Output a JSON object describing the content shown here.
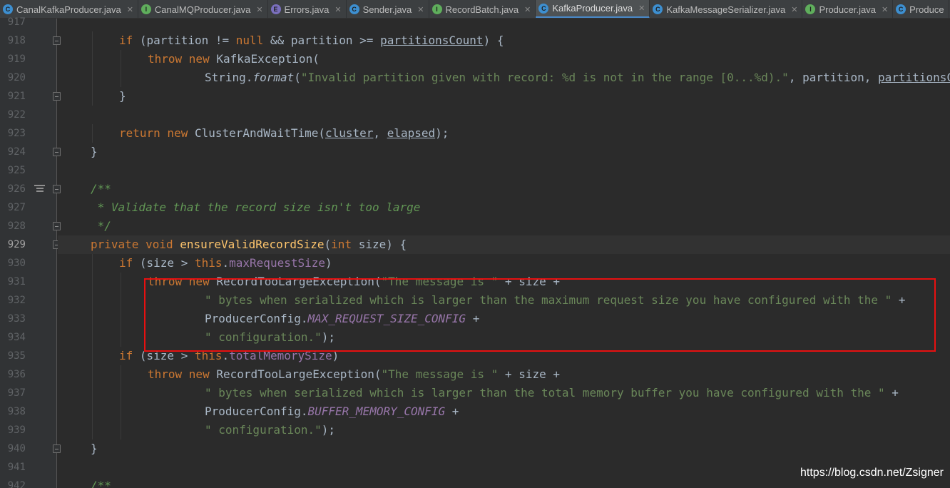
{
  "tabs": [
    {
      "label": "CanalKafkaProducer.java",
      "kind": "class",
      "active": false
    },
    {
      "label": "CanalMQProducer.java",
      "kind": "interface",
      "active": false
    },
    {
      "label": "Errors.java",
      "kind": "enum",
      "active": false
    },
    {
      "label": "Sender.java",
      "kind": "class",
      "active": false
    },
    {
      "label": "RecordBatch.java",
      "kind": "interface",
      "active": false
    },
    {
      "label": "KafkaProducer.java",
      "kind": "class",
      "active": true
    },
    {
      "label": "KafkaMessageSerializer.java",
      "kind": "class",
      "active": false
    },
    {
      "label": "Producer.java",
      "kind": "interface",
      "active": false
    },
    {
      "label": "Produce",
      "kind": "class",
      "active": false
    }
  ],
  "code_lines": [
    {
      "num": "917",
      "indent": 0,
      "tokens": []
    },
    {
      "num": "918",
      "indent": 2,
      "fold": true,
      "tokens": [
        {
          "t": "if",
          "c": "kw"
        },
        {
          "t": " (partition != "
        },
        {
          "t": "null",
          "c": "kw"
        },
        {
          "t": " && partition >= "
        },
        {
          "t": "partitionsCount",
          "c": "uline"
        },
        {
          "t": ") {"
        }
      ]
    },
    {
      "num": "919",
      "indent": 3,
      "tokens": [
        {
          "t": "throw new",
          "c": "kw"
        },
        {
          "t": " KafkaException("
        }
      ]
    },
    {
      "num": "920",
      "indent": 5,
      "tokens": [
        {
          "t": "String."
        },
        {
          "t": "format",
          "c": "ital"
        },
        {
          "t": "("
        },
        {
          "t": "\"Invalid partition given with record: %d is not in the range [0...%d).\"",
          "c": "str"
        },
        {
          "t": ", partition, "
        },
        {
          "t": "partitionsCount",
          "c": "uline"
        }
      ]
    },
    {
      "num": "921",
      "indent": 2,
      "fold": true,
      "tokens": [
        {
          "t": "}"
        }
      ]
    },
    {
      "num": "922",
      "indent": 0,
      "tokens": []
    },
    {
      "num": "923",
      "indent": 2,
      "tokens": [
        {
          "t": "return new",
          "c": "kw"
        },
        {
          "t": " ClusterAndWaitTime("
        },
        {
          "t": "cluster",
          "c": "uline"
        },
        {
          "t": ", "
        },
        {
          "t": "elapsed",
          "c": "uline"
        },
        {
          "t": ");"
        }
      ]
    },
    {
      "num": "924",
      "indent": 1,
      "fold": true,
      "tokens": [
        {
          "t": "}"
        }
      ]
    },
    {
      "num": "925",
      "indent": 0,
      "tokens": []
    },
    {
      "num": "926",
      "indent": 1,
      "fold": true,
      "doc": true,
      "tokens": [
        {
          "t": "/**",
          "c": "cmt"
        }
      ]
    },
    {
      "num": "927",
      "indent": 1,
      "tokens": [
        {
          "t": " * Validate that the record size isn't too large",
          "c": "cmt"
        }
      ]
    },
    {
      "num": "928",
      "indent": 1,
      "fold": true,
      "tokens": [
        {
          "t": " */",
          "c": "cmt"
        }
      ]
    },
    {
      "num": "929",
      "indent": 1,
      "fold": true,
      "current": true,
      "tokens": [
        {
          "t": "private void",
          "c": "kw"
        },
        {
          "t": " "
        },
        {
          "t": "ensureValidRecordSize",
          "c": "fn"
        },
        {
          "t": "("
        },
        {
          "t": "int",
          "c": "kw"
        },
        {
          "t": " size) {"
        }
      ]
    },
    {
      "num": "930",
      "indent": 2,
      "tokens": [
        {
          "t": "if",
          "c": "kw"
        },
        {
          "t": " (size > "
        },
        {
          "t": "this",
          "c": "kw"
        },
        {
          "t": "."
        },
        {
          "t": "maxRequestSize",
          "c": "fld"
        },
        {
          "t": ")"
        }
      ]
    },
    {
      "num": "931",
      "indent": 3,
      "tokens": [
        {
          "t": "throw new",
          "c": "kw"
        },
        {
          "t": " RecordTooLargeException("
        },
        {
          "t": "\"The message is \"",
          "c": "str"
        },
        {
          "t": " + size +"
        }
      ]
    },
    {
      "num": "932",
      "indent": 5,
      "tokens": [
        {
          "t": "\" bytes when serialized which is larger than the maximum request size you have configured with the \"",
          "c": "str"
        },
        {
          "t": " +"
        }
      ]
    },
    {
      "num": "933",
      "indent": 5,
      "tokens": [
        {
          "t": "ProducerConfig."
        },
        {
          "t": "MAX_REQUEST_SIZE_CONFIG",
          "c": "cst"
        },
        {
          "t": " +"
        }
      ]
    },
    {
      "num": "934",
      "indent": 5,
      "tokens": [
        {
          "t": "\" configuration.\"",
          "c": "str"
        },
        {
          "t": ");"
        }
      ]
    },
    {
      "num": "935",
      "indent": 2,
      "tokens": [
        {
          "t": "if",
          "c": "kw"
        },
        {
          "t": " (size > "
        },
        {
          "t": "this",
          "c": "kw"
        },
        {
          "t": "."
        },
        {
          "t": "totalMemorySize",
          "c": "fld"
        },
        {
          "t": ")"
        }
      ]
    },
    {
      "num": "936",
      "indent": 3,
      "tokens": [
        {
          "t": "throw new",
          "c": "kw"
        },
        {
          "t": " RecordTooLargeException("
        },
        {
          "t": "\"The message is \"",
          "c": "str"
        },
        {
          "t": " + size +"
        }
      ]
    },
    {
      "num": "937",
      "indent": 5,
      "tokens": [
        {
          "t": "\" bytes when serialized which is larger than the total memory buffer you have configured with the \"",
          "c": "str"
        },
        {
          "t": " +"
        }
      ]
    },
    {
      "num": "938",
      "indent": 5,
      "tokens": [
        {
          "t": "ProducerConfig."
        },
        {
          "t": "BUFFER_MEMORY_CONFIG",
          "c": "cst"
        },
        {
          "t": " +"
        }
      ]
    },
    {
      "num": "939",
      "indent": 5,
      "tokens": [
        {
          "t": "\" configuration.\"",
          "c": "str"
        },
        {
          "t": ");"
        }
      ]
    },
    {
      "num": "940",
      "indent": 1,
      "fold": true,
      "tokens": [
        {
          "t": "}"
        }
      ]
    },
    {
      "num": "941",
      "indent": 0,
      "tokens": []
    },
    {
      "num": "942",
      "indent": 1,
      "tokens": [
        {
          "t": "/**",
          "c": "cmt"
        }
      ]
    }
  ],
  "watermark": "https://blog.csdn.net/Zsigner",
  "colors": {
    "highlight_box": "#e81010",
    "active_tab_underline": "#4a88c7"
  }
}
